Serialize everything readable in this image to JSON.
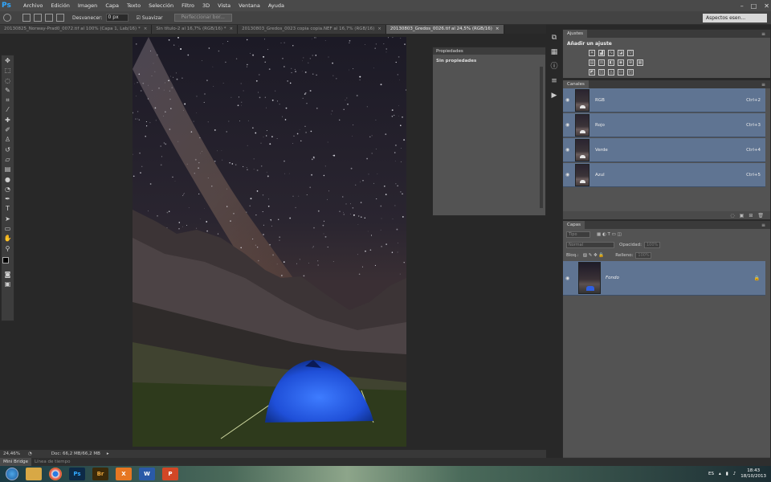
{
  "app": {
    "logo": "Ps",
    "menu": [
      "Archivo",
      "Edición",
      "Imagen",
      "Capa",
      "Texto",
      "Selección",
      "Filtro",
      "3D",
      "Vista",
      "Ventana",
      "Ayuda"
    ],
    "window_controls": [
      "–",
      "□",
      "✕"
    ]
  },
  "options_bar": {
    "feather_label": "Desvanecer:",
    "feather_value": "0 px",
    "antialias_label": "Suavizar",
    "refine_button": "Perfeccionar bor...",
    "workspace": "Aspectos esen..."
  },
  "tabs": [
    {
      "label": "20130825_Norway-Prad0_0072.tif al 100% (Capa 1, Lab/16) *",
      "active": false
    },
    {
      "label": "Sin título-2 al 16,7% (RGB/16) *",
      "active": false
    },
    {
      "label": "20130803_Gredos_0023 copia copia.NEF al 16,7% (RGB/16)",
      "active": false
    },
    {
      "label": "20130803_Gredos_0026.tif al 24,5% (RGB/16)",
      "active": true
    }
  ],
  "tool_icons": [
    "move-icon",
    "marquee-icon",
    "lasso-icon",
    "quick-select-icon",
    "crop-icon",
    "eyedropper-icon",
    "healing-icon",
    "brush-icon",
    "clone-stamp-icon",
    "history-brush-icon",
    "eraser-icon",
    "gradient-icon",
    "blur-icon",
    "dodge-icon",
    "pen-icon",
    "type-icon",
    "path-select-icon",
    "shape-icon",
    "hand-icon",
    "zoom-icon"
  ],
  "status": {
    "zoom": "24,46%",
    "doc_size": "Doc: 66,2 MB/66,2 MB"
  },
  "bottom_tabs": [
    "Mini Bridge",
    "Línea de tiempo"
  ],
  "properties_panel": {
    "title": "Propiedades",
    "subtitle": "Sin propiedades"
  },
  "adjustments_panel": {
    "tab": "Ajustes",
    "title": "Añadir un ajuste"
  },
  "channels_panel": {
    "tab": "Canales",
    "channels": [
      {
        "name": "RGB",
        "shortcut": "Ctrl+2"
      },
      {
        "name": "Rojo",
        "shortcut": "Ctrl+3"
      },
      {
        "name": "Verde",
        "shortcut": "Ctrl+4"
      },
      {
        "name": "Azul",
        "shortcut": "Ctrl+5"
      }
    ]
  },
  "layers_panel": {
    "tab": "Capas",
    "filter": "Tipo",
    "blend_mode": "Normal",
    "opacity_label": "Opacidad:",
    "opacity_value": "100%",
    "lock_label": "Bloq.:",
    "fill_label": "Relleno:",
    "fill_value": "100%",
    "layer_name": "Fondo"
  },
  "taskbar": {
    "apps": [
      {
        "name": "explorer",
        "label": "",
        "color": "#d8a845"
      },
      {
        "name": "chrome",
        "label": "",
        "color": "#e8e8e8"
      },
      {
        "name": "photoshop",
        "label": "Ps",
        "color": "#0d2a47"
      },
      {
        "name": "bridge",
        "label": "Br",
        "color": "#3b2a0a"
      },
      {
        "name": "app-x",
        "label": "X",
        "color": "#e67722"
      },
      {
        "name": "word",
        "label": "W",
        "color": "#2a5aa8"
      },
      {
        "name": "powerpoint",
        "label": "P",
        "color": "#d24726"
      }
    ],
    "language": "ES",
    "time": "18:43",
    "date": "18/10/2013"
  },
  "colors": {
    "selection": "#5f7492",
    "panel": "#535353",
    "background": "#282828"
  }
}
